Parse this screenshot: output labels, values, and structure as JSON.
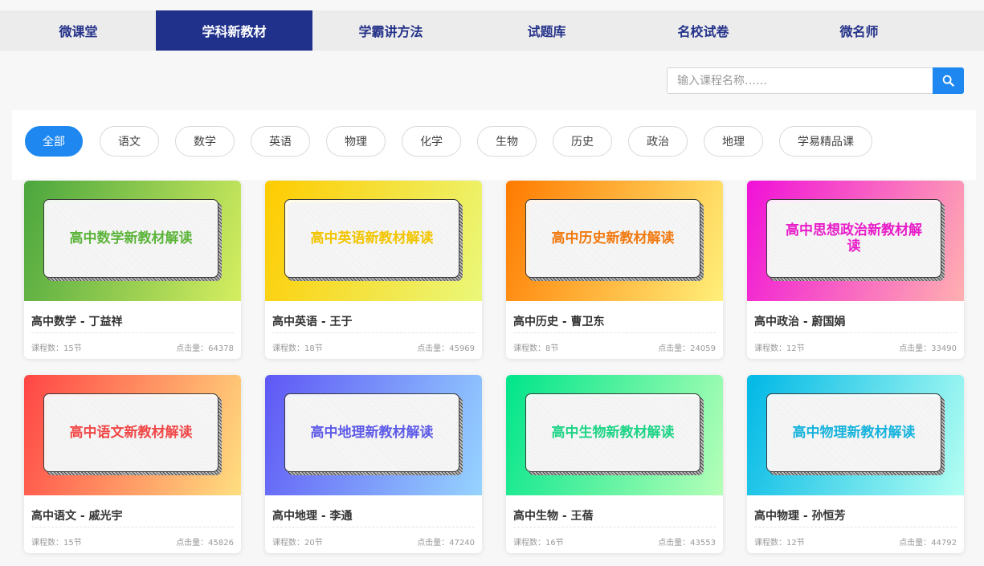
{
  "nav": {
    "tabs": [
      {
        "label": "微课堂"
      },
      {
        "label": "学科新教材"
      },
      {
        "label": "学霸讲方法"
      },
      {
        "label": "试题库"
      },
      {
        "label": "名校试卷"
      },
      {
        "label": "微名师"
      }
    ],
    "active_index": 1
  },
  "search": {
    "placeholder": "输入课程名称……",
    "value": ""
  },
  "filters": {
    "items": [
      {
        "label": "全部"
      },
      {
        "label": "语文"
      },
      {
        "label": "数学"
      },
      {
        "label": "英语"
      },
      {
        "label": "物理"
      },
      {
        "label": "化学"
      },
      {
        "label": "生物"
      },
      {
        "label": "历史"
      },
      {
        "label": "政治"
      },
      {
        "label": "地理"
      },
      {
        "label": "学易精品课"
      }
    ],
    "active_index": 0
  },
  "cards": [
    {
      "banner_text": "高中数学新教材解读",
      "title": "高中数学 - 丁益祥",
      "lessons": "课程数：15节",
      "clicks": "点击量：64378",
      "gradient": [
        "#4aa63e",
        "#d6ee60"
      ],
      "text_color": "#5cb43a"
    },
    {
      "banner_text": "高中英语新教材解读",
      "title": "高中英语 - 王于",
      "lessons": "课程数：18节",
      "clicks": "点击量：45969",
      "gradient": [
        "#ffcb00",
        "#eaf87a"
      ],
      "text_color": "#f2c500"
    },
    {
      "banner_text": "高中历史新教材解读",
      "title": "高中历史 - 曹卫东",
      "lessons": "课程数：8节",
      "clicks": "点击量：24059",
      "gradient": [
        "#ff7a00",
        "#fff07a"
      ],
      "text_color": "#f27a10"
    },
    {
      "banner_text": "高中思想政治新教材解读",
      "title": "高中政治 - 蔚国娟",
      "lessons": "课程数：12节",
      "clicks": "点击量：33490",
      "gradient": [
        "#f011d8",
        "#ffb0b0"
      ],
      "text_color": "#e81cc8"
    },
    {
      "banner_text": "高中语文新教材解读",
      "title": "高中语文 - 戚光宇",
      "lessons": "课程数：15节",
      "clicks": "点击量：45826",
      "gradient": [
        "#ff4545",
        "#ffdf80"
      ],
      "text_color": "#f04848"
    },
    {
      "banner_text": "高中地理新教材解读",
      "title": "高中地理 - 李通",
      "lessons": "课程数：20节",
      "clicks": "点击量：47240",
      "gradient": [
        "#5f57f5",
        "#96d4ff"
      ],
      "text_color": "#5e5be8"
    },
    {
      "banner_text": "高中生物新教材解读",
      "title": "高中生物 - 王蓓",
      "lessons": "课程数：16节",
      "clicks": "点击量：43553",
      "gradient": [
        "#00e58a",
        "#b6ffb8"
      ],
      "text_color": "#1dd486"
    },
    {
      "banner_text": "高中物理新教材解读",
      "title": "高中物理 - 孙恒芳",
      "lessons": "课程数：12节",
      "clicks": "点击量：44792",
      "gradient": [
        "#00b8e6",
        "#b4fff2"
      ],
      "text_color": "#16b3dc"
    }
  ],
  "colors": {
    "nav_active_bg": "#20318c",
    "nav_text": "#25338a",
    "accent_blue": "#1e88f0"
  }
}
